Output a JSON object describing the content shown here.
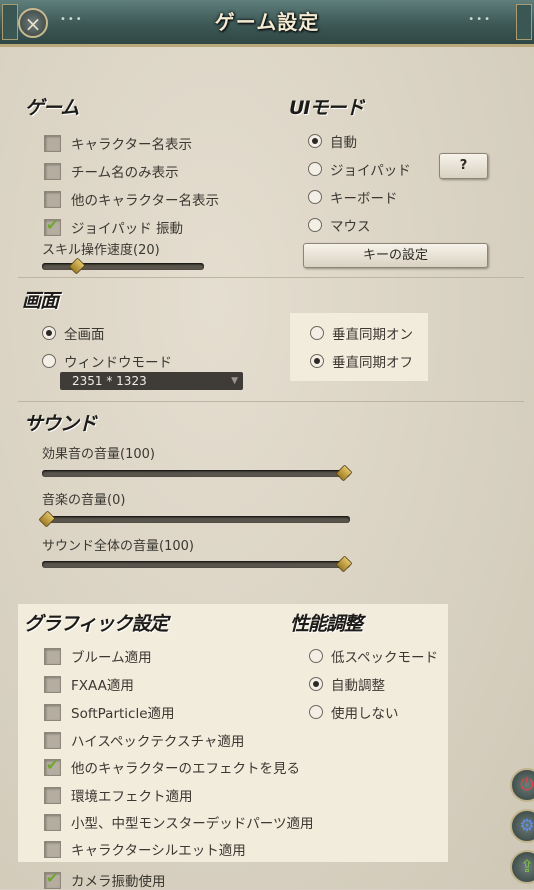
{
  "window": {
    "title": "ゲーム設定",
    "close_icon": "×"
  },
  "game": {
    "title": "ゲーム",
    "options": [
      {
        "label": "キャラクター名表示",
        "checked": false
      },
      {
        "label": "チーム名のみ表示",
        "checked": false
      },
      {
        "label": "他のキャラクター名表示",
        "checked": false
      },
      {
        "label": "ジョイパッド 振動",
        "checked": true
      }
    ],
    "skill_speed_label": "スキル操作速度(20)",
    "skill_speed_value": 20
  },
  "ui_mode": {
    "title": "UIモード",
    "options": [
      {
        "label": "自動",
        "selected": true
      },
      {
        "label": "ジョイパッド",
        "selected": false
      },
      {
        "label": "キーボード",
        "selected": false
      },
      {
        "label": "マウス",
        "selected": false
      }
    ],
    "help_label": "?",
    "key_settings_label": "キーの設定"
  },
  "screen": {
    "title": "画面",
    "modes": [
      {
        "label": "全画面",
        "selected": true
      },
      {
        "label": "ウィンドウモード",
        "selected": false
      }
    ],
    "resolution": "2351 * 1323",
    "vsync": [
      {
        "label": "垂直同期オン",
        "selected": false
      },
      {
        "label": "垂直同期オフ",
        "selected": true
      }
    ]
  },
  "sound": {
    "title": "サウンド",
    "sliders": [
      {
        "label": "効果音の音量(100)",
        "value": 100
      },
      {
        "label": "音楽の音量(0)",
        "value": 0
      },
      {
        "label": "サウンド全体の音量(100)",
        "value": 100
      }
    ]
  },
  "graphics": {
    "title": "グラフィック設定",
    "options": [
      {
        "label": "ブルーム適用",
        "checked": false
      },
      {
        "label": "FXAA適用",
        "checked": false
      },
      {
        "label": "SoftParticle適用",
        "checked": false
      },
      {
        "label": "ハイスペックテクスチャ適用",
        "checked": false
      },
      {
        "label": "他のキャラクターのエフェクトを見る",
        "checked": true
      },
      {
        "label": "環境エフェクト適用",
        "checked": false
      },
      {
        "label": "小型、中型モンスターデッドパーツ適用",
        "checked": false
      },
      {
        "label": "キャラクターシルエット適用",
        "checked": false
      },
      {
        "label": "カメラ振動使用",
        "checked": true
      }
    ]
  },
  "performance": {
    "title": "性能調整",
    "options": [
      {
        "label": "低スペックモード",
        "selected": false
      },
      {
        "label": "自動調整",
        "selected": true
      },
      {
        "label": "使用しない",
        "selected": false
      }
    ]
  },
  "side": {
    "icons": [
      "power-icon",
      "gear-icon",
      "share-icon"
    ]
  }
}
